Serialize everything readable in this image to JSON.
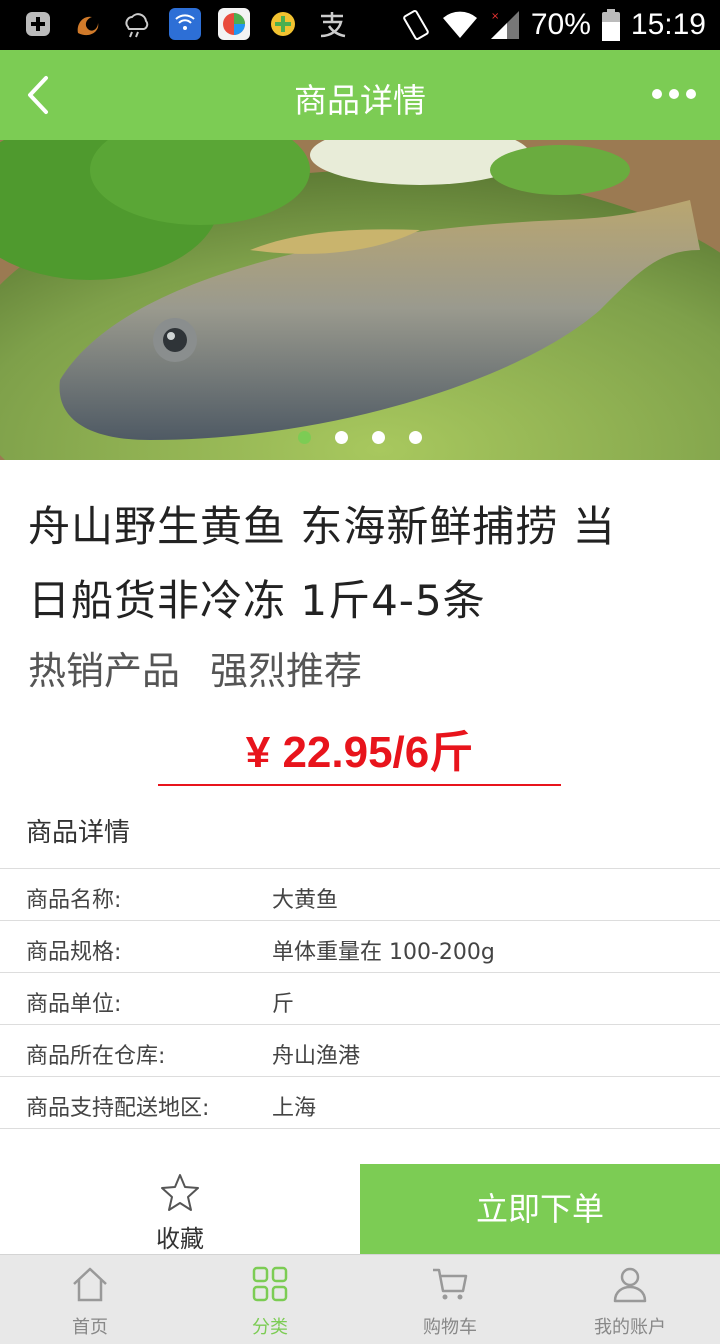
{
  "status_bar": {
    "battery": "70%",
    "time": "15:19",
    "icons": [
      "add-icon",
      "uc-browser-icon",
      "weather-icon",
      "wifi-app-icon",
      "app-store-icon",
      "plus-app-icon",
      "alipay-icon",
      "rotate-icon",
      "wifi-icon",
      "signal-icon",
      "battery-icon"
    ]
  },
  "header": {
    "title": "商品详情"
  },
  "carousel": {
    "slides": 4,
    "active_index": 0
  },
  "product": {
    "title_line1": "舟山野生黄鱼 东海新鲜捕捞 当",
    "title_line2": "日船货非冷冻 1斤4-5条",
    "tag1": "热销产品",
    "tag2": "强烈推荐",
    "price": "¥ 22.95/6斤"
  },
  "details": {
    "heading": "商品详情",
    "rows": [
      {
        "label": "商品名称:",
        "value": "大黄鱼"
      },
      {
        "label": "商品规格:",
        "value": "单体重量在 100-200g"
      },
      {
        "label": "商品单位:",
        "value": "斤"
      },
      {
        "label": "商品所在仓库:",
        "value": "舟山渔港"
      },
      {
        "label": "商品支持配送地区:",
        "value": "上海"
      }
    ]
  },
  "actions": {
    "favorite_label": "收藏",
    "buy_label": "立即下单"
  },
  "tabs": [
    {
      "label": "首页",
      "icon": "home-icon"
    },
    {
      "label": "分类",
      "icon": "category-icon",
      "active": true
    },
    {
      "label": "购物车",
      "icon": "cart-icon"
    },
    {
      "label": "我的账户",
      "icon": "user-icon"
    }
  ],
  "colors": {
    "accent": "#7ccc54",
    "price": "#e8141c"
  }
}
